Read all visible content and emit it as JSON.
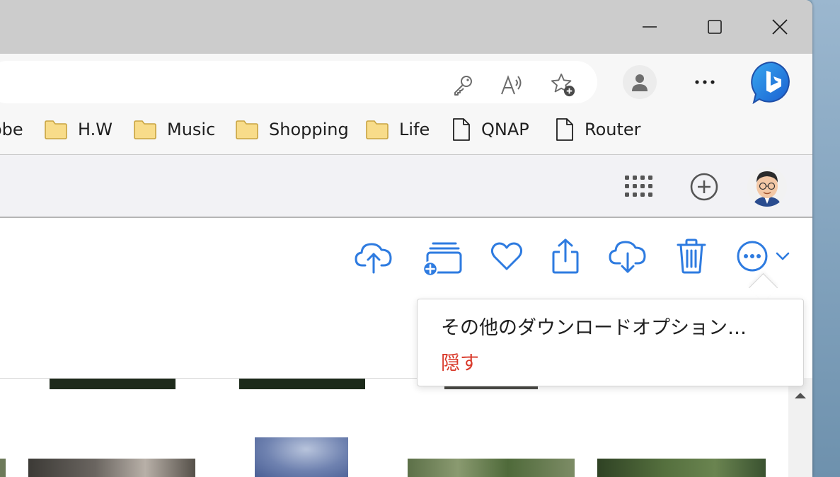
{
  "window_controls": {
    "minimize_icon": "minimize-icon",
    "maximize_icon": "maximize-icon",
    "close_icon": "close-icon"
  },
  "address_bar": {
    "icons": [
      "key-icon",
      "read-aloud-icon",
      "add-favorite-icon"
    ]
  },
  "browser_toolbar": {
    "icons": [
      "profile-icon",
      "more-icon",
      "bing-copilot-icon"
    ]
  },
  "favorites": [
    {
      "label": "obe",
      "type": "folder"
    },
    {
      "label": "H.W",
      "type": "folder"
    },
    {
      "label": "Music",
      "type": "folder"
    },
    {
      "label": "Shopping",
      "type": "folder"
    },
    {
      "label": "Life",
      "type": "folder"
    },
    {
      "label": "QNAP",
      "type": "page"
    },
    {
      "label": "Router",
      "type": "page"
    }
  ],
  "app_header": {
    "icons": [
      "app-grid-icon",
      "add-circle-icon",
      "account-avatar"
    ]
  },
  "photo_toolbar": {
    "icons": [
      "upload-icon",
      "add-to-album-icon",
      "favorite-icon",
      "share-icon",
      "download-icon",
      "delete-icon",
      "more-options-icon",
      "chevron-down-icon"
    ]
  },
  "menu": {
    "items": [
      {
        "label": "その他のダウンロードオプション…",
        "color": "#1f1f1f"
      },
      {
        "label": "隠す",
        "color": "#d93a2b"
      }
    ]
  },
  "colors": {
    "accent": "#2e7be0",
    "folder_fill": "#f8dc8a",
    "folder_stroke": "#c9a440",
    "danger": "#d93a2b"
  }
}
